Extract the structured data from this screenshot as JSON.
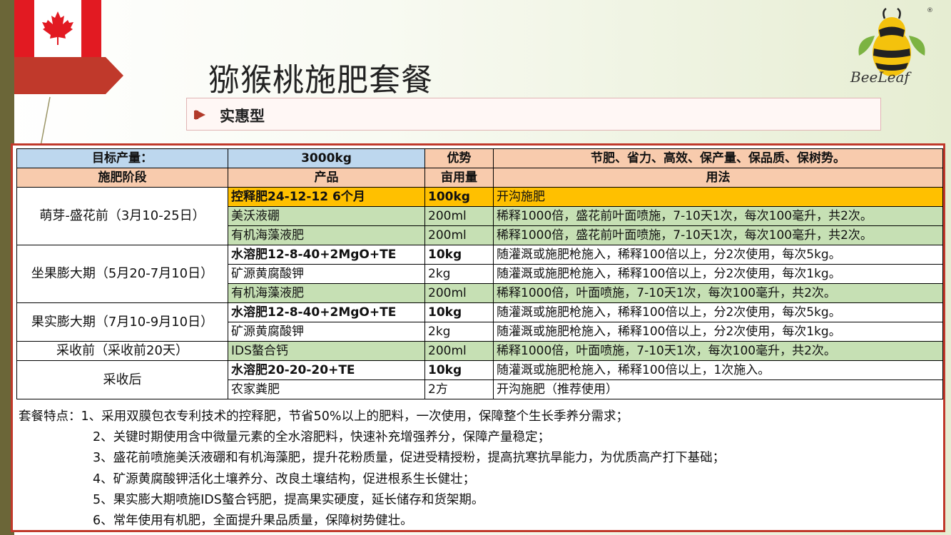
{
  "title": "猕猴桃施肥套餐",
  "subtitle": "实惠型",
  "logo_text": "BeeLeaf",
  "logo_mark": "®",
  "table": {
    "row1": {
      "label": "目标产量：",
      "value": "3000kg",
      "adv_label": "优势",
      "adv_value": "节肥、省力、高效、保产量、保品质、保树势。"
    },
    "row2": {
      "stage": "施肥阶段",
      "product": "产品",
      "amount": "亩用量",
      "usage": "用法"
    },
    "stages": [
      "萌芽-盛花前（3月10-25日）",
      "坐果膨大期（5月20-7月10日）",
      "果实膨大期（7月10-9月10日）",
      "采收前（采收前20天）",
      "采收后"
    ],
    "rows": [
      {
        "product": "控释肥24-12-12 6个月",
        "amount": "100kg",
        "usage": "开沟施肥"
      },
      {
        "product": "美沃液硼",
        "amount": "200ml",
        "usage": "稀释1000倍，盛花前叶面喷施，7-10天1次，每次100毫升，共2次。"
      },
      {
        "product": "有机海藻液肥",
        "amount": "200ml",
        "usage": "稀释1000倍，盛花前叶面喷施，7-10天1次，每次100毫升，共2次。"
      },
      {
        "product": "水溶肥12-8-40+2MgO+TE",
        "amount": "10kg",
        "usage": "随灌溉或施肥枪施入，稀释100倍以上，分2次使用，每次5kg。"
      },
      {
        "product": "矿源黄腐酸钾",
        "amount": "2kg",
        "usage": "随灌溉或施肥枪施入，稀释100倍以上，分2次使用，每次1kg。"
      },
      {
        "product": "有机海藻液肥",
        "amount": "200ml",
        "usage": "稀释1000倍，叶面喷施，7-10天1次，每次100毫升，共2次。"
      },
      {
        "product": "水溶肥12-8-40+2MgO+TE",
        "amount": "10kg",
        "usage": "随灌溉或施肥枪施入，稀释100倍以上，分2次使用，每次5kg。"
      },
      {
        "product": "矿源黄腐酸钾",
        "amount": "2kg",
        "usage": "随灌溉或施肥枪施入，稀释100倍以上，分2次使用，每次1kg。"
      },
      {
        "product": "IDS螯合钙",
        "amount": "200ml",
        "usage": "稀释1000倍，叶面喷施，7-10天1次，每次100毫升，共2次。"
      },
      {
        "product": "水溶肥20-20-20+TE",
        "amount": "10kg",
        "usage": "随灌溉或施肥枪施入，稀释100倍以上，1次施入。"
      },
      {
        "product": "农家粪肥",
        "amount": "2方",
        "usage": "开沟施肥（推荐使用）"
      }
    ]
  },
  "notes": [
    "套餐特点：1、采用双膜包衣专利技术的控释肥，节省50%以上的肥料，一次使用，保障整个生长季养分需求；",
    "2、关键时期使用含中微量元素的全水溶肥料，快速补充增强养分，保障产量稳定；",
    "3、盛花前喷施美沃液硼和有机海藻肥，提升花粉质量，促进受精授粉，提高抗寒抗旱能力，为优质高产打下基础；",
    "4、矿源黄腐酸钾活化土壤养分、改良土壤结构，促进根系生长健壮；",
    "5、果实膨大期喷施IDS螯合钙肥，提高果实硬度，延长储存和货架期。",
    "6、常年使用有机肥，全面提升果品质量，保障树势健壮。"
  ],
  "colors": {
    "accent": "#c0392b",
    "header_blue": "#bdd7ee",
    "header_salmon": "#f8cbad",
    "orange": "#ffc000",
    "green": "#c6e0b4"
  }
}
